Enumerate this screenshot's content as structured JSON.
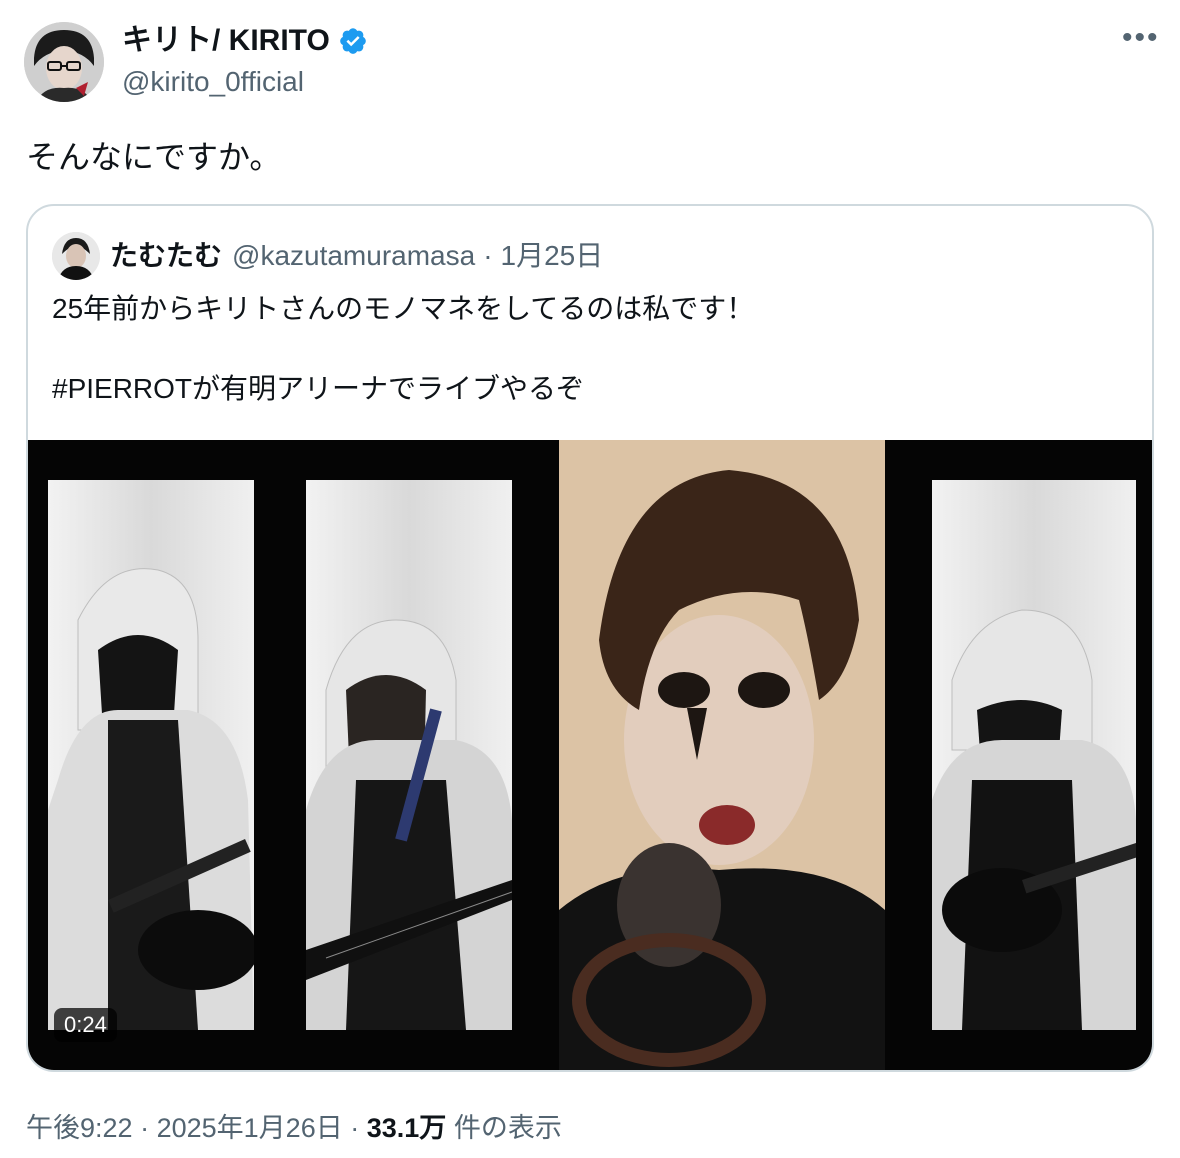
{
  "author": {
    "display_name": "キリト/ KIRITO",
    "handle": "@kirito_0fficial",
    "verified_icon": "verified-badge-icon",
    "more_label": "•••"
  },
  "tweet": {
    "text": "そんなにですか。"
  },
  "quoted": {
    "display_name": "たむたむ",
    "handle": "@kazutamuramasa",
    "separator": "·",
    "date": "1月25日",
    "line1": "25年前からキリトさんのモノマネをしてるのは私です！",
    "line2": "#PIERROTが有明アリーナでライブやるぞ",
    "media": {
      "type": "video",
      "duration": "0:24"
    }
  },
  "footer": {
    "time": "午後9:22",
    "sep1": "·",
    "date": "2025年1月26日",
    "sep2": "·",
    "views_count": "33.1万",
    "views_label": "件の表示"
  },
  "colors": {
    "text": "#0f1419",
    "secondary": "#536471",
    "border": "#cfd9de",
    "verified": "#1d9bf0"
  }
}
